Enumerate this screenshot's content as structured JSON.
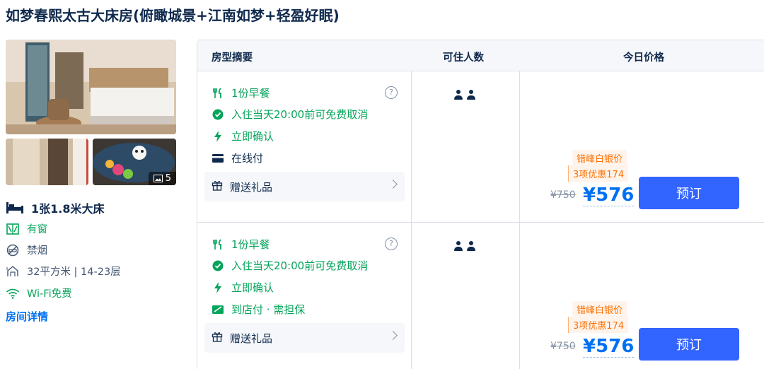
{
  "room": {
    "title": "如梦春熙太古大床房(俯瞰城景+江南如梦+轻盈好眠)",
    "photo_count": "5",
    "bed": "1张1.8米大床",
    "amenities": [
      {
        "label": "有窗",
        "icon": "window-icon"
      },
      {
        "label": "禁烟",
        "icon": "no-smoking-icon"
      },
      {
        "label": "32平方米 | 14-23层",
        "icon": "area-icon"
      },
      {
        "label": "Wi-Fi免费",
        "icon": "wifi-icon"
      }
    ],
    "details_link": "房间详情"
  },
  "table": {
    "headers": [
      "房型摘要",
      "可住人数",
      "今日价格"
    ]
  },
  "offers": [
    {
      "breakfast": "1份早餐",
      "cancel": "入住当天20:00前可免费取消",
      "confirm": "立即确认",
      "payment": "在线付",
      "gift": "赠送礼品",
      "help": "?",
      "promo_tag": "错峰白银价",
      "promo_sub": "3项优惠174",
      "original_price": "¥750",
      "price": "¥576",
      "book": "预订"
    },
    {
      "breakfast": "1份早餐",
      "cancel": "入住当天20:00前可免费取消",
      "confirm": "立即确认",
      "payment": "到店付 · 需担保",
      "gift": "赠送礼品",
      "help": "?",
      "promo_tag": "错峰白银价",
      "promo_sub": "3项优惠174",
      "original_price": "¥750",
      "price": "¥576",
      "book": "预订"
    }
  ],
  "colors": {
    "accent": "#0070f2",
    "button": "#3264ff",
    "green": "#06a45b",
    "promo": "#ff6f00",
    "text": "#0f294d"
  }
}
